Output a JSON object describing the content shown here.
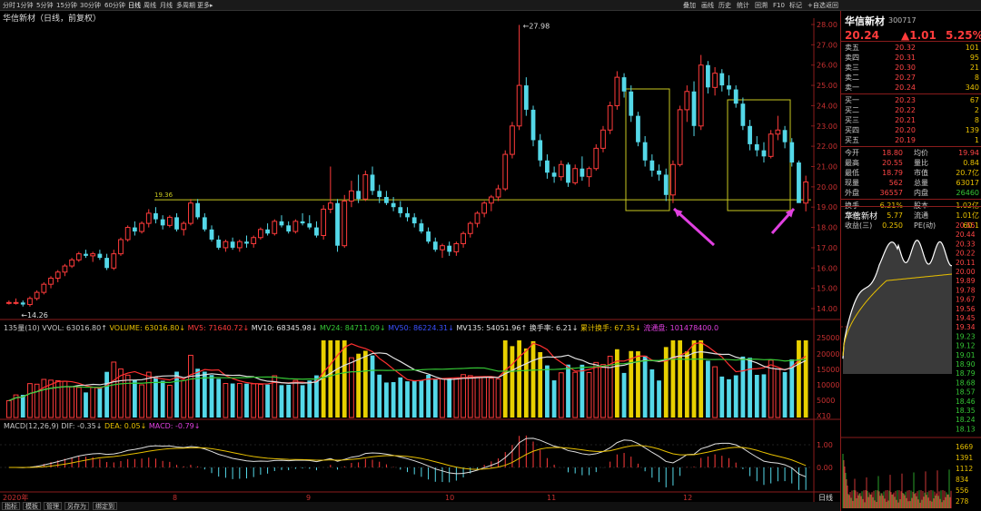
{
  "topbar": {
    "left": [
      {
        "label": "分时",
        "x": 3
      },
      {
        "label": "1分钟",
        "x": 18
      },
      {
        "label": "5分钟",
        "x": 40
      },
      {
        "label": "15分钟",
        "x": 62
      },
      {
        "label": "30分钟",
        "x": 88
      },
      {
        "label": "60分钟",
        "x": 115
      },
      {
        "label": "日线",
        "x": 141,
        "active": true
      },
      {
        "label": "周线",
        "x": 158
      },
      {
        "label": "月线",
        "x": 176
      },
      {
        "label": "多周期",
        "x": 194
      },
      {
        "label": "更多▸",
        "x": 217
      }
    ],
    "right": [
      {
        "label": "叠加",
        "x": 752
      },
      {
        "label": "画线",
        "x": 772
      },
      {
        "label": "历史",
        "x": 791
      },
      {
        "label": "统计",
        "x": 811
      },
      {
        "label": "回溯",
        "x": 831
      },
      {
        "label": "F10",
        "x": 851
      },
      {
        "label": "标记",
        "x": 869
      },
      {
        "label": "+自选",
        "x": 889
      },
      {
        "label": "返回",
        "x": 909
      }
    ]
  },
  "title": "华信新材（日线，前复权）",
  "price_axis": [
    "28.00",
    "27.00",
    "26.00",
    "25.00",
    "24.00",
    "23.00",
    "22.00",
    "21.00",
    "20.00",
    "19.00",
    "18.00",
    "17.00",
    "16.00",
    "15.00",
    "14.00"
  ],
  "annotations": {
    "high": "27.98",
    "low": "14.26",
    "support_label": "19.36"
  },
  "volume_header": [
    {
      "t": "135量(10) VVOL: 63016.80↑",
      "c": "#c8c8c8"
    },
    {
      "t": "VOLUME: 63016.80↓",
      "c": "#e8c000"
    },
    {
      "t": "MV5: 71640.72↓",
      "c": "#ff3b3b"
    },
    {
      "t": "MV10: 68345.98↓",
      "c": "#e0e0e0"
    },
    {
      "t": "MV24: 84711.09↓",
      "c": "#35c835"
    },
    {
      "t": "MV50: 86224.31↓",
      "c": "#3b50ff"
    },
    {
      "t": "MV135: 54051.96↑",
      "c": "#e0e0e0"
    },
    {
      "t": "换手率: 6.21↓",
      "c": "#e0e0e0"
    },
    {
      "t": "累计换手: 67.35↓",
      "c": "#e8c000"
    },
    {
      "t": "流通盘: 101478400.0",
      "c": "#e040e0"
    }
  ],
  "volume_axis": [
    "25000",
    "20000",
    "15000",
    "10000",
    "5000",
    "X10"
  ],
  "macd_header": [
    {
      "t": "MACD(12,26,9) DIF: -0.35↓",
      "c": "#c8c8c8"
    },
    {
      "t": "DEA: 0.05↓",
      "c": "#e8c000"
    },
    {
      "t": "MACD: -0.79↓",
      "c": "#e040e0"
    }
  ],
  "macd_axis": [
    "1.00",
    "0.00"
  ],
  "date_axis": [
    {
      "label": "2020年",
      "x": 3
    },
    {
      "label": "8",
      "x": 190
    },
    {
      "label": "9",
      "x": 337
    },
    {
      "label": "10",
      "x": 490
    },
    {
      "label": "11",
      "x": 602
    },
    {
      "label": "12",
      "x": 752
    }
  ],
  "period_label": "日线",
  "bottom_tabs": [
    "指标",
    "模板",
    "管理",
    "另存为",
    "绑定到"
  ],
  "quote": {
    "name": "华信新材",
    "code": "300717",
    "price": "20.24",
    "change": "▲1.01",
    "pct": "5.25%",
    "asks": [
      {
        "label": "卖五",
        "price": "20.32",
        "vol": "101"
      },
      {
        "label": "卖四",
        "price": "20.31",
        "vol": "95"
      },
      {
        "label": "卖三",
        "price": "20.30",
        "vol": "21"
      },
      {
        "label": "卖二",
        "price": "20.27",
        "vol": "8"
      },
      {
        "label": "卖一",
        "price": "20.24",
        "vol": "340"
      }
    ],
    "bids": [
      {
        "label": "买一",
        "price": "20.23",
        "vol": "67"
      },
      {
        "label": "买二",
        "price": "20.22",
        "vol": "2"
      },
      {
        "label": "买三",
        "price": "20.21",
        "vol": "8"
      },
      {
        "label": "买四",
        "price": "20.20",
        "vol": "139"
      },
      {
        "label": "买五",
        "price": "20.19",
        "vol": "1"
      }
    ],
    "stats": [
      {
        "a": "今开",
        "b": "18.80",
        "bc": "up",
        "c": "均价",
        "d": "19.94",
        "dc": "up"
      },
      {
        "a": "最高",
        "b": "20.55",
        "bc": "up",
        "c": "量比",
        "d": "0.84",
        "dc": "yl"
      },
      {
        "a": "最低",
        "b": "18.79",
        "bc": "up",
        "c": "市值",
        "d": "20.7亿",
        "dc": "yl"
      },
      {
        "a": "现量",
        "b": "562",
        "bc": "up",
        "c": "总量",
        "d": "63017",
        "dc": "yl"
      },
      {
        "a": "外盘",
        "b": "36557",
        "bc": "up",
        "c": "内盘",
        "d": "26460",
        "dc": "dn"
      }
    ],
    "stats2": [
      {
        "a": "换手",
        "b": "6.21%",
        "bc": "yl",
        "c": "股本",
        "d": "1.02亿",
        "dc": "yl"
      },
      {
        "a": "净资",
        "b": "5.77",
        "bc": "yl",
        "c": "流通",
        "d": "1.01亿",
        "dc": "yl"
      },
      {
        "a": "收益(三)",
        "b": "0.250",
        "bc": "yl",
        "c": "PE(动)",
        "d": "60.1",
        "dc": "yl"
      }
    ],
    "mini_title": "华信新材",
    "mini_axis_up": [
      "20.55",
      "20.44",
      "20.33",
      "20.22",
      "20.11",
      "20.00",
      "19.89",
      "19.78",
      "19.67",
      "19.56",
      "19.45",
      "19.34"
    ],
    "mini_axis_dn": [
      "19.23",
      "19.12",
      "19.01",
      "18.90",
      "18.79",
      "18.68",
      "18.57",
      "18.46",
      "18.35",
      "18.24",
      "18.13"
    ],
    "mini_vol_axis": [
      "1669",
      "1391",
      "1112",
      "834",
      "556",
      "278"
    ]
  },
  "colors": {
    "up": "#ff3b3b",
    "down": "#54d8e8",
    "support": "#c8c820",
    "arrow": "#e040e0"
  },
  "chart_data": {
    "type": "candlestick",
    "title": "华信新材（日线，前复权）",
    "ylim": [
      14.0,
      28.0
    ],
    "support_level": 19.36,
    "candles": [
      [
        14.3,
        14.4,
        14.2,
        14.3
      ],
      [
        14.3,
        14.5,
        14.2,
        14.3
      ],
      [
        14.3,
        14.4,
        14.1,
        14.2
      ],
      [
        14.2,
        14.6,
        14.1,
        14.5
      ],
      [
        14.5,
        14.9,
        14.4,
        14.8
      ],
      [
        14.8,
        15.3,
        14.7,
        15.2
      ],
      [
        15.2,
        15.6,
        15.0,
        15.5
      ],
      [
        15.5,
        15.9,
        15.3,
        15.8
      ],
      [
        15.8,
        16.2,
        15.6,
        16.1
      ],
      [
        16.1,
        16.5,
        16.0,
        16.4
      ],
      [
        16.4,
        16.8,
        16.3,
        16.7
      ],
      [
        16.7,
        16.9,
        16.5,
        16.6
      ],
      [
        16.6,
        16.8,
        16.3,
        16.7
      ],
      [
        16.7,
        16.9,
        16.4,
        16.5
      ],
      [
        16.5,
        16.7,
        15.9,
        16.0
      ],
      [
        16.0,
        16.9,
        15.9,
        16.7
      ],
      [
        16.7,
        17.5,
        16.6,
        17.4
      ],
      [
        17.4,
        18.1,
        17.3,
        18.0
      ],
      [
        18.0,
        18.3,
        17.6,
        17.8
      ],
      [
        17.8,
        18.3,
        17.7,
        18.2
      ],
      [
        18.2,
        18.9,
        18.0,
        18.7
      ],
      [
        18.7,
        19.0,
        18.2,
        18.4
      ],
      [
        18.4,
        18.6,
        17.9,
        18.1
      ],
      [
        18.1,
        18.6,
        18.0,
        18.5
      ],
      [
        18.5,
        18.7,
        17.8,
        17.9
      ],
      [
        17.9,
        18.3,
        17.6,
        18.2
      ],
      [
        18.2,
        19.4,
        18.1,
        19.2
      ],
      [
        19.2,
        19.4,
        18.4,
        18.5
      ],
      [
        18.5,
        18.7,
        17.8,
        17.9
      ],
      [
        17.9,
        18.1,
        17.3,
        17.4
      ],
      [
        17.4,
        17.6,
        16.9,
        17.0
      ],
      [
        17.0,
        17.4,
        16.8,
        17.3
      ],
      [
        17.3,
        17.5,
        16.9,
        17.0
      ],
      [
        17.0,
        17.4,
        16.8,
        17.3
      ],
      [
        17.3,
        17.6,
        17.0,
        17.2
      ],
      [
        17.2,
        17.6,
        17.0,
        17.5
      ],
      [
        17.5,
        18.0,
        17.4,
        17.9
      ],
      [
        17.9,
        18.2,
        17.6,
        17.7
      ],
      [
        17.7,
        18.4,
        17.6,
        18.3
      ],
      [
        18.3,
        18.6,
        18.0,
        18.1
      ],
      [
        18.1,
        18.3,
        17.7,
        17.8
      ],
      [
        17.8,
        18.4,
        17.7,
        18.3
      ],
      [
        18.3,
        18.7,
        18.1,
        18.2
      ],
      [
        18.2,
        18.6,
        17.9,
        18.0
      ],
      [
        18.0,
        18.3,
        17.5,
        17.6
      ],
      [
        17.6,
        19.1,
        17.4,
        18.9
      ],
      [
        18.9,
        21.0,
        18.7,
        19.2
      ],
      [
        19.2,
        19.4,
        16.8,
        17.1
      ],
      [
        17.1,
        19.6,
        17.0,
        19.3
      ],
      [
        19.3,
        20.3,
        19.0,
        19.8
      ],
      [
        19.8,
        20.6,
        19.2,
        19.4
      ],
      [
        19.4,
        20.8,
        19.3,
        20.6
      ],
      [
        20.6,
        21.0,
        19.6,
        19.8
      ],
      [
        19.8,
        20.1,
        19.2,
        19.5
      ],
      [
        19.5,
        19.8,
        19.1,
        19.2
      ],
      [
        19.2,
        19.5,
        18.8,
        19.0
      ],
      [
        19.0,
        19.3,
        18.5,
        18.7
      ],
      [
        18.7,
        19.0,
        18.3,
        18.5
      ],
      [
        18.5,
        18.7,
        18.0,
        18.2
      ],
      [
        18.2,
        18.4,
        17.7,
        17.8
      ],
      [
        17.8,
        18.0,
        17.2,
        17.3
      ],
      [
        17.3,
        17.5,
        16.8,
        16.9
      ],
      [
        16.9,
        17.2,
        16.5,
        17.1
      ],
      [
        17.1,
        17.3,
        16.6,
        16.8
      ],
      [
        16.8,
        17.3,
        16.6,
        17.2
      ],
      [
        17.2,
        17.8,
        17.0,
        17.7
      ],
      [
        17.7,
        18.3,
        17.5,
        18.2
      ],
      [
        18.2,
        18.8,
        18.0,
        18.7
      ],
      [
        18.7,
        19.3,
        18.5,
        19.2
      ],
      [
        19.2,
        19.6,
        18.8,
        19.5
      ],
      [
        19.5,
        20.1,
        19.3,
        19.9
      ],
      [
        19.9,
        21.8,
        19.8,
        21.6
      ],
      [
        21.6,
        23.2,
        21.4,
        23.0
      ],
      [
        23.0,
        27.98,
        22.8,
        25.0
      ],
      [
        25.0,
        25.4,
        23.5,
        23.8
      ],
      [
        23.8,
        24.0,
        22.0,
        22.3
      ],
      [
        22.3,
        22.6,
        21.0,
        21.3
      ],
      [
        21.3,
        21.6,
        20.4,
        20.7
      ],
      [
        20.7,
        21.0,
        20.2,
        20.5
      ],
      [
        20.5,
        21.3,
        20.3,
        21.1
      ],
      [
        21.1,
        21.2,
        20.0,
        20.2
      ],
      [
        20.2,
        21.1,
        20.1,
        20.9
      ],
      [
        20.9,
        21.5,
        20.3,
        20.5
      ],
      [
        20.5,
        21.0,
        20.0,
        20.9
      ],
      [
        20.9,
        22.1,
        20.8,
        21.9
      ],
      [
        21.9,
        23.0,
        21.7,
        22.8
      ],
      [
        22.8,
        24.2,
        22.6,
        24.0
      ],
      [
        24.0,
        25.7,
        23.8,
        25.4
      ],
      [
        25.4,
        25.6,
        24.4,
        24.7
      ],
      [
        24.7,
        25.0,
        23.2,
        23.5
      ],
      [
        23.5,
        23.7,
        22.0,
        22.2
      ],
      [
        22.2,
        22.5,
        21.0,
        21.3
      ],
      [
        21.3,
        21.6,
        20.5,
        20.8
      ],
      [
        20.8,
        21.1,
        20.3,
        20.6
      ],
      [
        20.6,
        20.9,
        19.3,
        19.6
      ],
      [
        19.6,
        21.3,
        19.2,
        21.1
      ],
      [
        21.1,
        24.0,
        21.0,
        23.8
      ],
      [
        23.8,
        25.0,
        23.2,
        24.7
      ],
      [
        24.7,
        25.2,
        22.5,
        23.0
      ],
      [
        23.0,
        26.5,
        22.8,
        26.0
      ],
      [
        26.0,
        26.2,
        24.6,
        24.9
      ],
      [
        24.9,
        25.9,
        24.5,
        25.6
      ],
      [
        25.6,
        25.8,
        24.7,
        25.0
      ],
      [
        25.0,
        25.5,
        24.5,
        24.8
      ],
      [
        24.8,
        25.0,
        23.9,
        24.1
      ],
      [
        24.1,
        24.4,
        22.8,
        23.0
      ],
      [
        23.0,
        23.3,
        21.8,
        22.1
      ],
      [
        22.1,
        22.5,
        21.5,
        21.8
      ],
      [
        21.8,
        22.2,
        21.2,
        21.5
      ],
      [
        21.5,
        22.8,
        21.4,
        22.6
      ],
      [
        22.6,
        23.5,
        22.3,
        22.8
      ],
      [
        22.8,
        23.0,
        21.9,
        22.2
      ],
      [
        22.2,
        22.4,
        21.0,
        21.2
      ],
      [
        21.2,
        21.3,
        19.3,
        19.2
      ],
      [
        19.2,
        20.55,
        18.79,
        20.24
      ]
    ]
  }
}
